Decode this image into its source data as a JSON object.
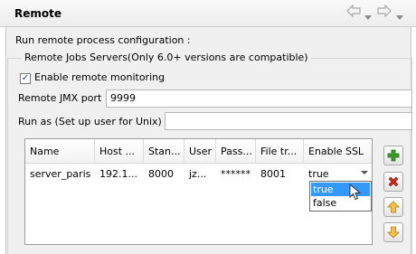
{
  "header": {
    "title": "Remote",
    "nav_icons": [
      "back-arrow-icon",
      "chevron-down-icon",
      "forward-arrow-icon",
      "chevron-down-icon"
    ]
  },
  "main": {
    "description": "Run remote process configuration :",
    "group_title": "Remote Jobs Servers(Only 6.0+ versions are compatible)",
    "enable_label": "Enable remote monitoring",
    "enable_checked": true,
    "jmx_label": "Remote JMX port",
    "jmx_value": "9999",
    "run_as_label": "Run as (Set up user for Unix) :",
    "run_as_value": ""
  },
  "table": {
    "headers": [
      "Name",
      "Host ...",
      "Stan...",
      "User",
      "Pass...",
      "File tr...",
      "Enable SSL"
    ],
    "rows": [
      [
        "server_paris",
        "192.1...",
        "8000",
        "jz...",
        "******",
        "8001",
        "true"
      ]
    ]
  },
  "dropdown": {
    "options": [
      "true",
      "false"
    ],
    "selected": "true"
  },
  "side_buttons": [
    "add-icon",
    "delete-icon",
    "move-up-icon",
    "move-down-icon"
  ],
  "colors": {
    "add": "#3a9a2a",
    "delete": "#c8281e",
    "arrow": "#e0a830",
    "selection": "#3399ff"
  }
}
